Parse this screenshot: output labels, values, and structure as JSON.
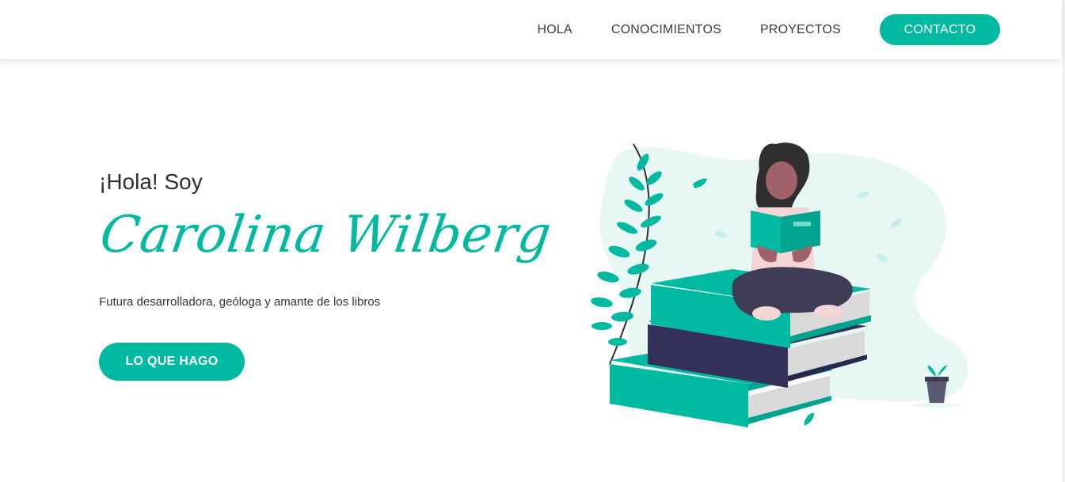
{
  "nav": {
    "items": [
      {
        "label": "HOLA"
      },
      {
        "label": "CONOCIMIENTOS"
      },
      {
        "label": "PROYECTOS"
      }
    ],
    "cta_label": "CONTACTO"
  },
  "hero": {
    "greeting": "¡Hola! Soy",
    "name": "Carolina Wilberg",
    "subtitle": "Futura desarrolladora, geóloga y amante de los libros",
    "button_label": "LO QUE HAGO"
  },
  "colors": {
    "accent": "#00b9a1",
    "text": "#333333",
    "book_dark": "#33305a",
    "blob": "#e6f7f4"
  },
  "illustration": {
    "icon": "woman-reading-on-books-illustration"
  }
}
